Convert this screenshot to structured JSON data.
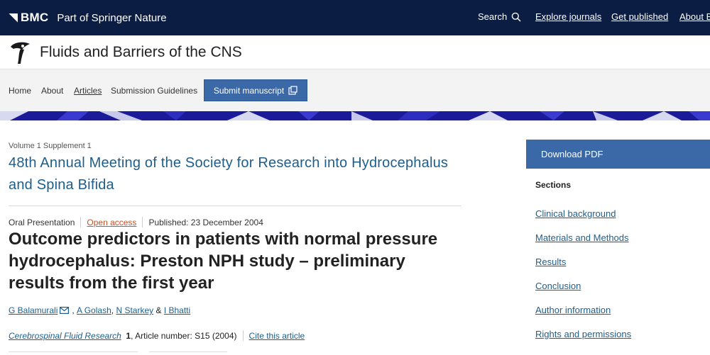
{
  "topbar": {
    "brand": "BMC",
    "part_of": "Part of Springer Nature",
    "search_label": "Search",
    "explore": "Explore journals",
    "get_published": "Get published",
    "about": "About BMC"
  },
  "journal": {
    "title": "Fluids and Barriers of the CNS"
  },
  "nav": {
    "home": "Home",
    "about": "About",
    "articles": "Articles",
    "guidelines": "Submission Guidelines",
    "submit": "Submit manuscript"
  },
  "article": {
    "volume": "Volume 1 Supplement 1",
    "supplement_title": "48th Annual Meeting of the Society for Research into Hydrocephalus and Spina Bifida",
    "type": "Oral Presentation",
    "open_access": "Open access",
    "published": "Published: 23 December 2004",
    "title": "Outcome predictors in patients with normal pressure hydrocephalus: Preston NPH study – preliminary results from the first year",
    "authors": [
      {
        "name": "G Balamurali"
      },
      {
        "name": "A Golash"
      },
      {
        "name": "N Starkey"
      },
      {
        "name": "I Bhatti"
      }
    ],
    "author_sep": ",",
    "author_and": "&",
    "journal_name": "Cerebrospinal Fluid Research",
    "volume_number": "1",
    "article_number": ", Article number: S15 (2004)",
    "cite": "Cite this article"
  },
  "sidebar": {
    "download": "Download PDF",
    "sections_heading": "Sections",
    "sections": [
      "Clinical background",
      "Materials and Methods",
      "Results",
      "Conclusion",
      "Author information",
      "Rights and permissions"
    ]
  },
  "colors": {
    "topbar": "#0c1d44",
    "accent_blue": "#3b69a8",
    "link_blue": "#1d5e8c",
    "open_access": "#c2532a",
    "banner_navy": "#1b1b9a"
  },
  "icons": {
    "search": "magnifier-icon",
    "submit": "external-window-icon",
    "mail": "envelope-icon",
    "logo": "journal-logo-icon"
  }
}
